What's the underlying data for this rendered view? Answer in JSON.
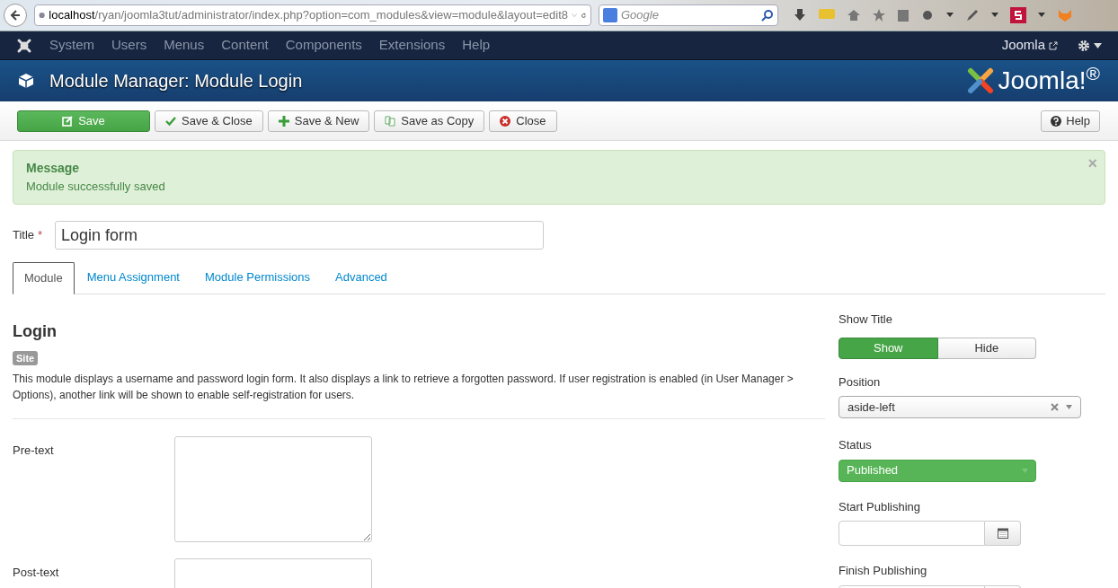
{
  "browser": {
    "url_host": "localhost",
    "url_path": "/ryan/joomla3tut/administrator/index.php?option=com_modules&view=module&layout=edit8",
    "search_placeholder": "Google"
  },
  "navbar": {
    "menu": [
      "System",
      "Users",
      "Menus",
      "Content",
      "Components",
      "Extensions",
      "Help"
    ],
    "site_link": "Joomla"
  },
  "header": {
    "title": "Module Manager: Module Login",
    "brand": "Joomla!$^{®}$"
  },
  "toolbar": {
    "buttons": [
      {
        "label": "Save",
        "kind": "save"
      },
      {
        "label": "Save & Close",
        "kind": "check"
      },
      {
        "label": "Save & New",
        "kind": "plus"
      },
      {
        "label": "Save as Copy",
        "kind": "copy"
      },
      {
        "label": "Close",
        "kind": "close"
      }
    ],
    "help": "Help"
  },
  "message": {
    "heading": "Message",
    "text": "Module successfully saved",
    "close": "×"
  },
  "title_field": {
    "label": "Title",
    "required_mark": "*",
    "value": "Login form"
  },
  "tabs": [
    {
      "label": "Module",
      "selected": true
    },
    {
      "label": "Menu Assignment",
      "selected": false
    },
    {
      "label": "Module Permissions",
      "selected": false
    },
    {
      "label": "Advanced",
      "selected": false
    }
  ],
  "module": {
    "name": "Login",
    "badge": "Site",
    "description": "This module displays a username and password login form. It also displays a link to retrieve a forgotten password. If user registration is enabled (in User Manager > Options), another link will be shown to enable self-registration for users."
  },
  "fields": [
    {
      "label": "Pre-text",
      "kind": "textarea"
    },
    {
      "label": "Post-text",
      "kind": "textarea"
    }
  ],
  "sidebar": {
    "show_title": {
      "label": "Show Title",
      "options": [
        {
          "label": "Show",
          "selected": true
        },
        {
          "label": "Hide",
          "selected": false
        }
      ]
    },
    "position": {
      "label": "Position",
      "value": "aside-left"
    },
    "status": {
      "label": "Status",
      "value": "Published"
    },
    "dates": [
      {
        "label": "Start Publishing"
      },
      {
        "label": "Finish Publishing"
      }
    ]
  }
}
